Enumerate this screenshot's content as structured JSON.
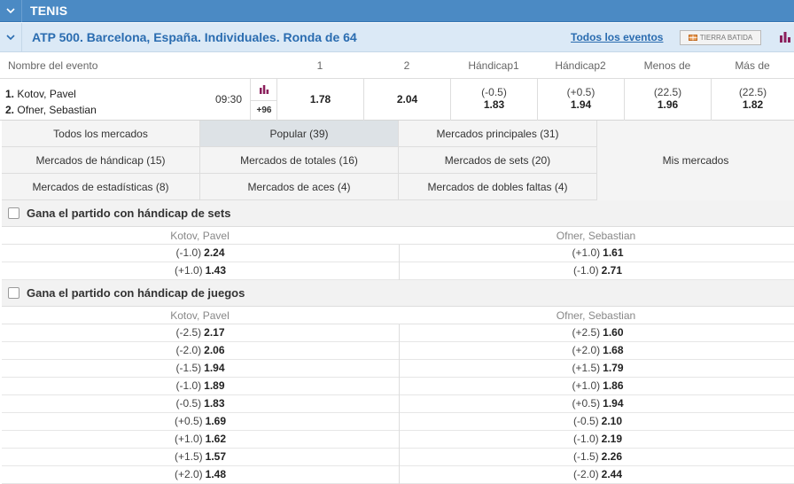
{
  "sport": {
    "title": "TENIS"
  },
  "league": {
    "title": "ATP 500. Barcelona, España. Individuales. Ronda de 64",
    "all_events": "Todos los eventos",
    "surface": "TIERRA BATIDA"
  },
  "columns": {
    "event_name": "Nombre del evento",
    "c1": "1",
    "c2": "2",
    "hcap1": "Hándicap1",
    "hcap2": "Hándicap2",
    "under": "Menos de",
    "over": "Más de"
  },
  "event": {
    "p1_num": "1.",
    "p1_name": "Kotov, Pavel",
    "p2_num": "2.",
    "p2_name": "Ofner, Sebastian",
    "time": "09:30",
    "more_markets": "+96",
    "odd1": "1.78",
    "odd2": "2.04",
    "hcap1_line": "(-0.5)",
    "hcap1_val": "1.83",
    "hcap2_line": "(+0.5)",
    "hcap2_val": "1.94",
    "under_line": "(22.5)",
    "under_val": "1.96",
    "over_line": "(22.5)",
    "over_val": "1.82"
  },
  "market_tabs": {
    "all": "Todos los mercados",
    "popular": "Popular (39)",
    "main": "Mercados principales (31)",
    "handicap": "Mercados de hándicap (15)",
    "totals": "Mercados de totales (16)",
    "sets": "Mercados de sets (20)",
    "stats": "Mercados de estadísticas (8)",
    "aces": "Mercados de aces (4)",
    "double_faults": "Mercados de dobles faltas (4)",
    "mine": "Mis mercados"
  },
  "market_sets": {
    "title": "Gana el partido con hándicap de sets",
    "player1": "Kotov, Pavel",
    "player2": "Ofner, Sebastian",
    "rows": [
      {
        "l_line": "(-1.0)",
        "l_val": "2.24",
        "r_line": "(+1.0)",
        "r_val": "1.61"
      },
      {
        "l_line": "(+1.0)",
        "l_val": "1.43",
        "r_line": "(-1.0)",
        "r_val": "2.71"
      }
    ]
  },
  "market_games": {
    "title": "Gana el partido con hándicap de juegos",
    "player1": "Kotov, Pavel",
    "player2": "Ofner, Sebastian",
    "rows": [
      {
        "l_line": "(-2.5)",
        "l_val": "2.17",
        "r_line": "(+2.5)",
        "r_val": "1.60"
      },
      {
        "l_line": "(-2.0)",
        "l_val": "2.06",
        "r_line": "(+2.0)",
        "r_val": "1.68"
      },
      {
        "l_line": "(-1.5)",
        "l_val": "1.94",
        "r_line": "(+1.5)",
        "r_val": "1.79"
      },
      {
        "l_line": "(-1.0)",
        "l_val": "1.89",
        "r_line": "(+1.0)",
        "r_val": "1.86"
      },
      {
        "l_line": "(-0.5)",
        "l_val": "1.83",
        "r_line": "(+0.5)",
        "r_val": "1.94"
      },
      {
        "l_line": "(+0.5)",
        "l_val": "1.69",
        "r_line": "(-0.5)",
        "r_val": "2.10"
      },
      {
        "l_line": "(+1.0)",
        "l_val": "1.62",
        "r_line": "(-1.0)",
        "r_val": "2.19"
      },
      {
        "l_line": "(+1.5)",
        "l_val": "1.57",
        "r_line": "(-1.5)",
        "r_val": "2.26"
      },
      {
        "l_line": "(+2.0)",
        "l_val": "1.48",
        "r_line": "(-2.0)",
        "r_val": "2.44"
      }
    ]
  }
}
